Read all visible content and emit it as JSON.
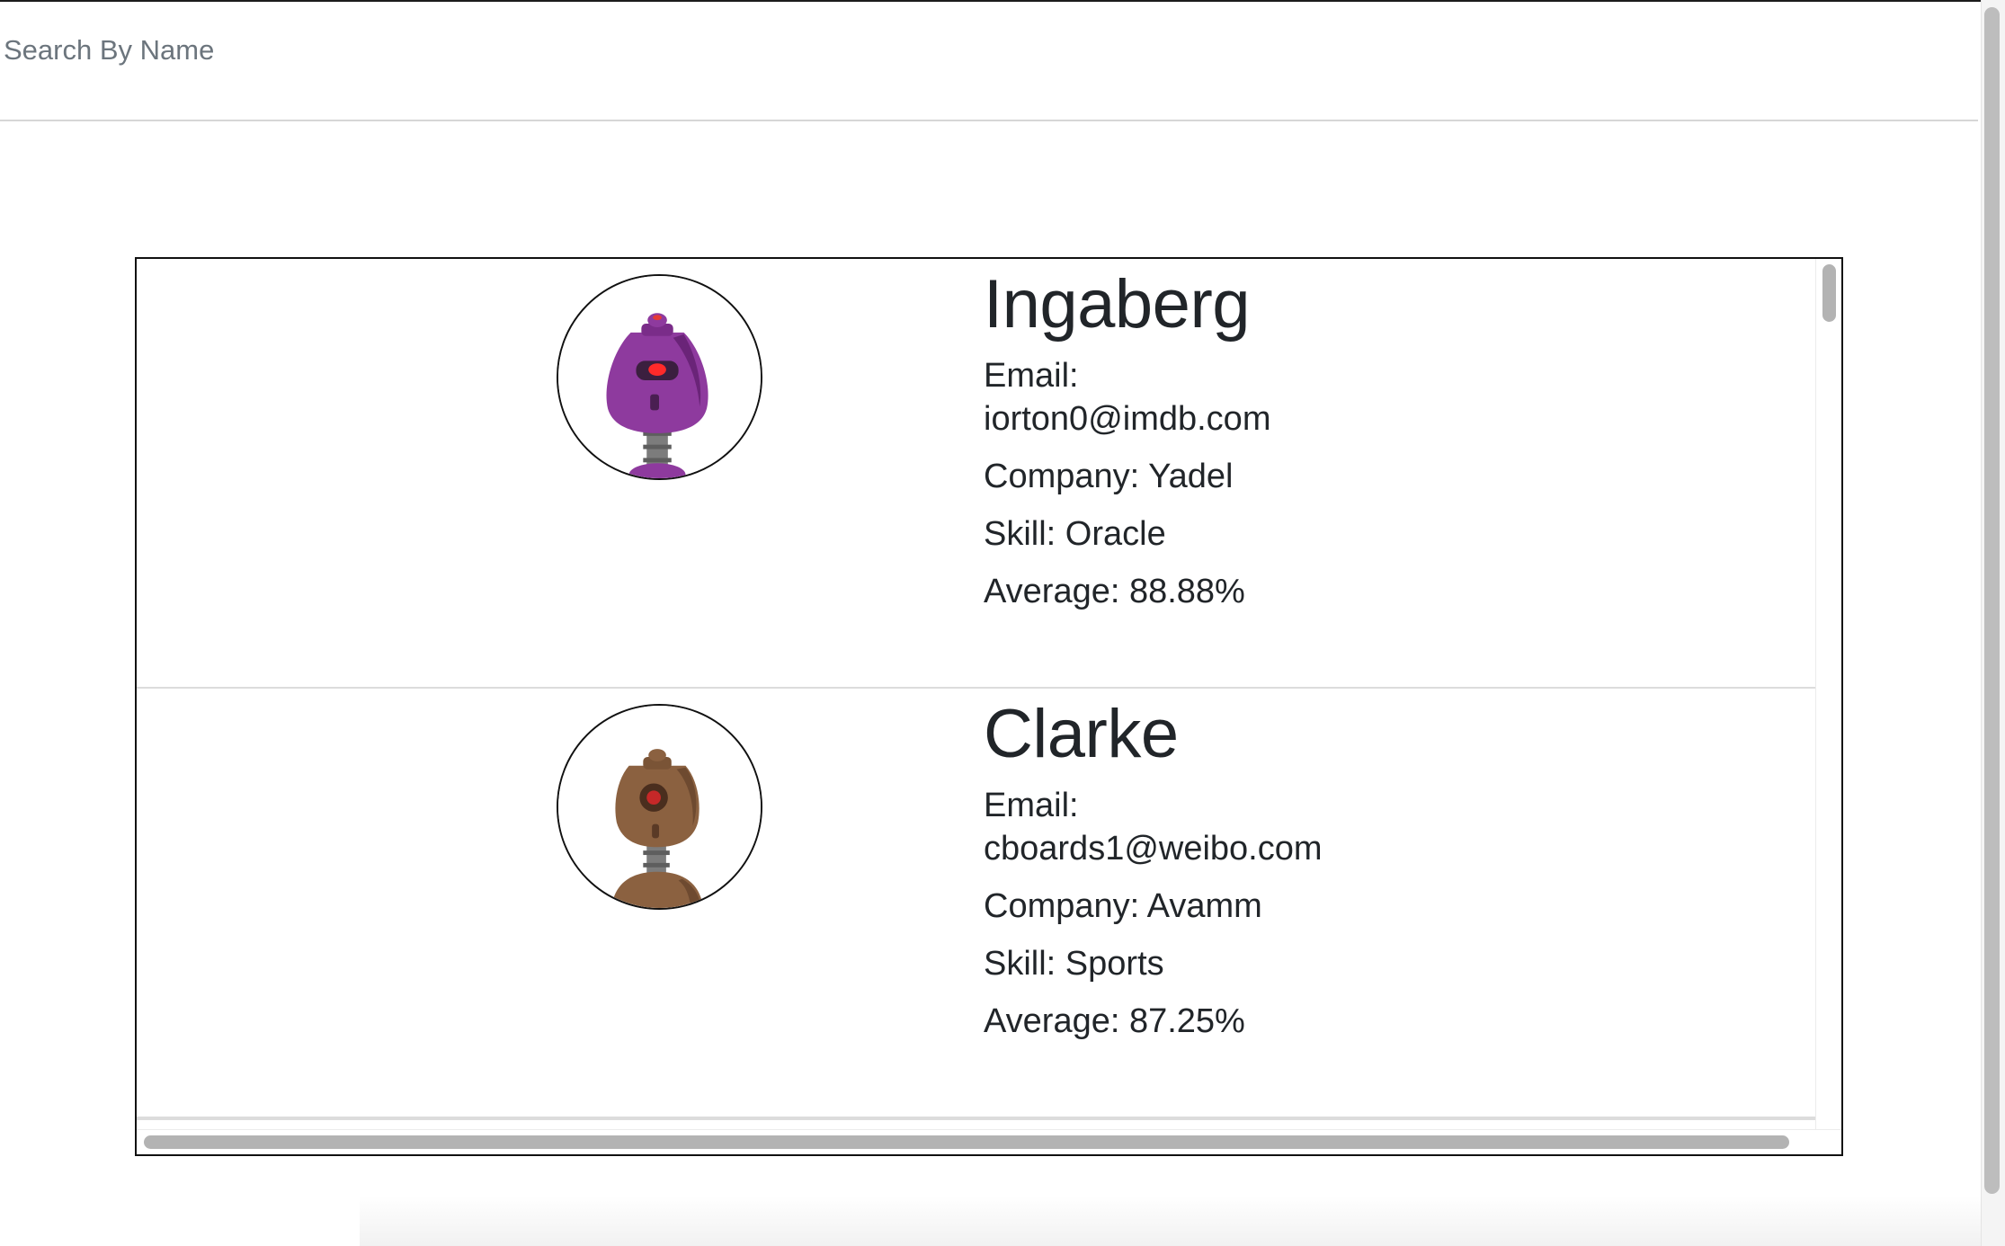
{
  "search": {
    "placeholder": "Search By Name",
    "value": ""
  },
  "people": [
    {
      "name": "Ingaberg",
      "email_label": "Email:",
      "email": "iorton0@imdb.com",
      "company_label": "Company:",
      "company": "Yadel",
      "skill_label": "Skill:",
      "skill": "Oracle",
      "average_label": "Average:",
      "average": "88.88%",
      "avatar_icon": "purple-robot-icon",
      "avatar_color": "#8e3a9e"
    },
    {
      "name": "Clarke",
      "email_label": "Email:",
      "email": "cboards1@weibo.com",
      "company_label": "Company:",
      "company": "Avamm",
      "skill_label": "Skill:",
      "skill": "Sports",
      "average_label": "Average:",
      "average": "87.25%",
      "avatar_icon": "brown-robot-icon",
      "avatar_color": "#8b6140"
    }
  ],
  "colors": {
    "text": "#212529",
    "placeholder": "#6c757d",
    "border": "#111111",
    "divider": "#dcdcdc",
    "scrollbar_thumb": "#b3b3b3"
  }
}
